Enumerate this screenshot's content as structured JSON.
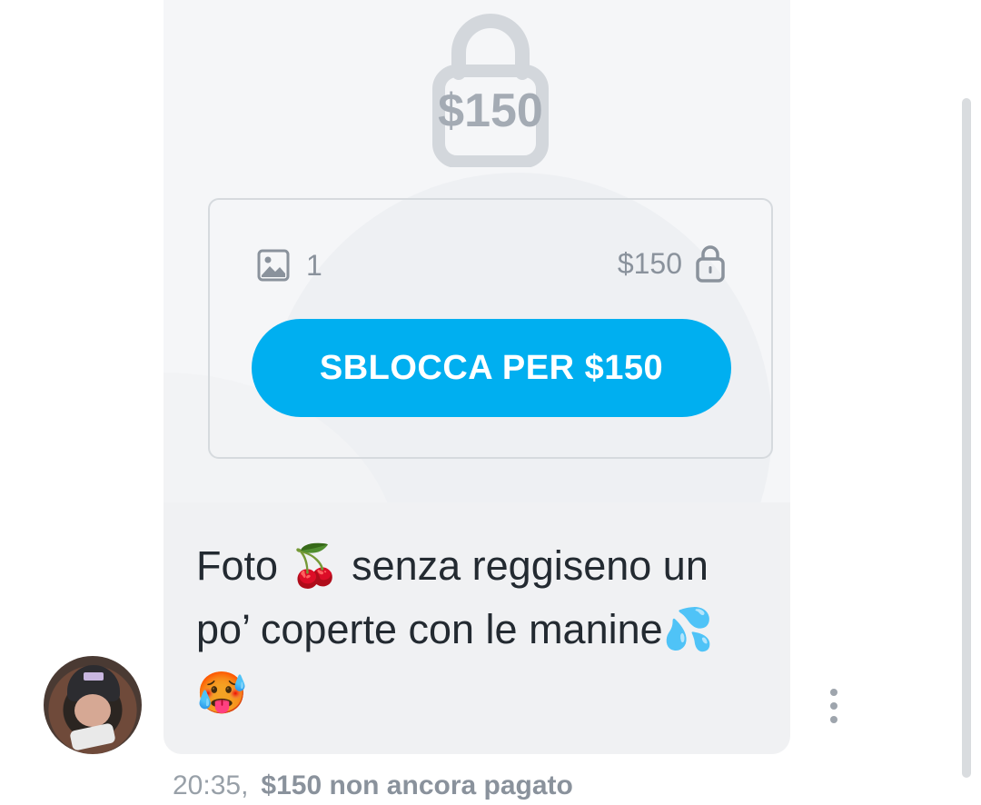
{
  "locked_media": {
    "overlay_price": "$150",
    "media_count": "1",
    "price": "$150",
    "unlock_button_label": "SBLOCCA PER $150"
  },
  "message": {
    "caption_line1": "Foto 🍒 senza reggiseno un",
    "caption_line2": "po’ coperte con le manine💦",
    "caption_line3": "🥵",
    "time": "20:35,",
    "payment_status": "$150 non ancora pagato"
  },
  "colors": {
    "accent": "#00aff0",
    "bubble_bg": "#f0f1f3",
    "muted_text": "#8a929c"
  },
  "icons": {
    "lock": "lock-icon",
    "image": "image-icon",
    "more": "more-vertical-icon"
  }
}
